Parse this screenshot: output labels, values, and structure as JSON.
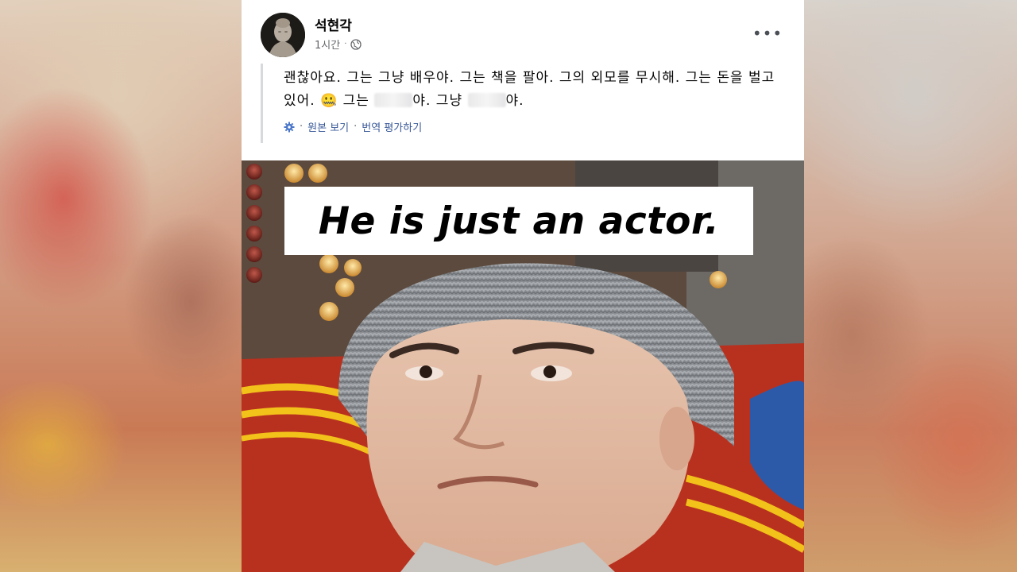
{
  "post": {
    "author": "석현각",
    "time": "1시간",
    "meta_separator": "·",
    "body_text_part1": "괜찮아요. 그는 그냥 배우야. 그는 책을 팔아. 그의 외모를 무시해. 그는 돈을 벌고 있어. ",
    "emoji_glyph": "🤐",
    "body_text_part2": " 그는 ",
    "body_text_part3": "야. 그냥 ",
    "body_text_part4": "야.",
    "see_original": "원본 보기",
    "translate_separator": "·",
    "rate_translation": "번역 평가하기",
    "more_options": "•••"
  },
  "photo": {
    "caption": "He is just an actor."
  },
  "icons": {
    "globe": "globe-icon",
    "gear": "gear-icon",
    "more": "more-options-icon"
  },
  "colors": {
    "link": "#385898",
    "meta": "#65676b",
    "card_bg": "#ffffff"
  }
}
